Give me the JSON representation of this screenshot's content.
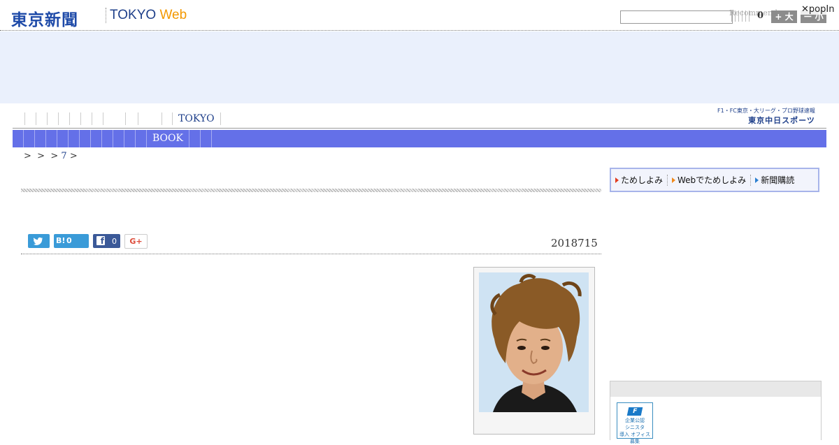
{
  "header": {
    "logo_jp": "東京新聞",
    "logo_en": "TOKYO",
    "logo_web": "Web",
    "recommend": "Recommend",
    "count": "0",
    "btn_big": "+ 大",
    "btn_small": "ー 小",
    "popin": "popIn"
  },
  "nav": {
    "tokyo": "TOKYO",
    "book": "BOOK",
    "chunichi_top": "F1・FC東京・大リーグ・プロ野球速報",
    "chunichi_name": "東京中日スポーツ"
  },
  "breadcrumb": {
    "sep1": ">",
    "sep2": ">",
    "sep3": ">",
    "item": "7",
    "sep4": ">"
  },
  "subscription": {
    "item1": "ためしよみ",
    "item2": "Webでためしよみ",
    "item3": "新聞購読"
  },
  "share": {
    "hatena_label": "B!",
    "hatena_count": "0",
    "facebook_count": "0",
    "gplus_label": "G+"
  },
  "article": {
    "date": "2018715"
  },
  "sidebar": {
    "logo_line1": "企業公認",
    "logo_line2": "シニスタ",
    "logo_line3": "導入 オフィス",
    "logo_line4": "募集"
  },
  "colors": {
    "brand_blue": "#1e4aa8",
    "web_orange": "#f39800",
    "menu_bar": "#6470e8",
    "ad_banner": "#eaf0fc"
  }
}
